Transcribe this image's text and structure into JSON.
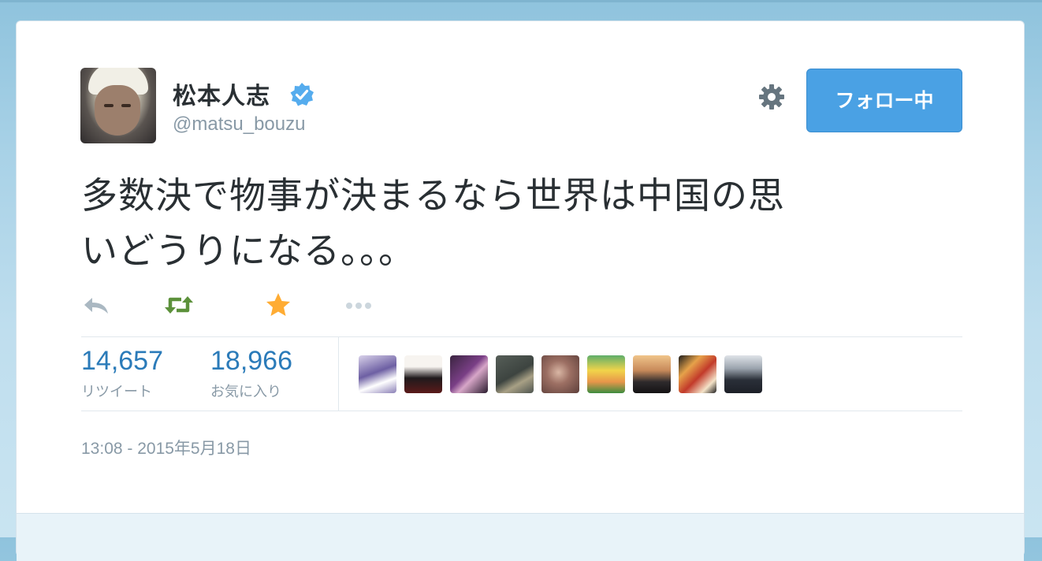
{
  "user": {
    "name": "松本人志",
    "handle": "@matsu_bouzu",
    "verified_icon": "verified-badge-icon",
    "avatar": "avatar"
  },
  "header": {
    "settings_icon": "gear-icon",
    "follow_label": "フォロー中"
  },
  "tweet": {
    "line1": "多数決で物事が決まるなら世界は中国の思",
    "line2": "いどうりになる。。。"
  },
  "actions": {
    "reply_icon": "reply-icon",
    "retweet_icon": "retweet-icon",
    "favorite_icon": "star-icon",
    "more_icon": "more-dots-icon"
  },
  "stats": {
    "retweets": {
      "count": "14,657",
      "label": "リツイート"
    },
    "favorites": {
      "count": "18,966",
      "label": "お気に入り"
    }
  },
  "favoriter_avatars": [
    "anime-girl-avatar",
    "dark-figure-avatar",
    "purple-portrait-avatar",
    "chalkboard-avatar",
    "blurry-face-avatar",
    "spongebob-avatar",
    "sunset-couple-avatar",
    "tiger-cartoon-avatar",
    "group-photo-avatar"
  ],
  "timestamp": "13:08 - 2015年5月18日",
  "colors": {
    "follow_button": "#4aa1e4",
    "link_blue": "#2b7bb9",
    "retweet_green": "#5c913b",
    "favorite_orange": "#ffac33",
    "muted_text": "#8899a6"
  }
}
